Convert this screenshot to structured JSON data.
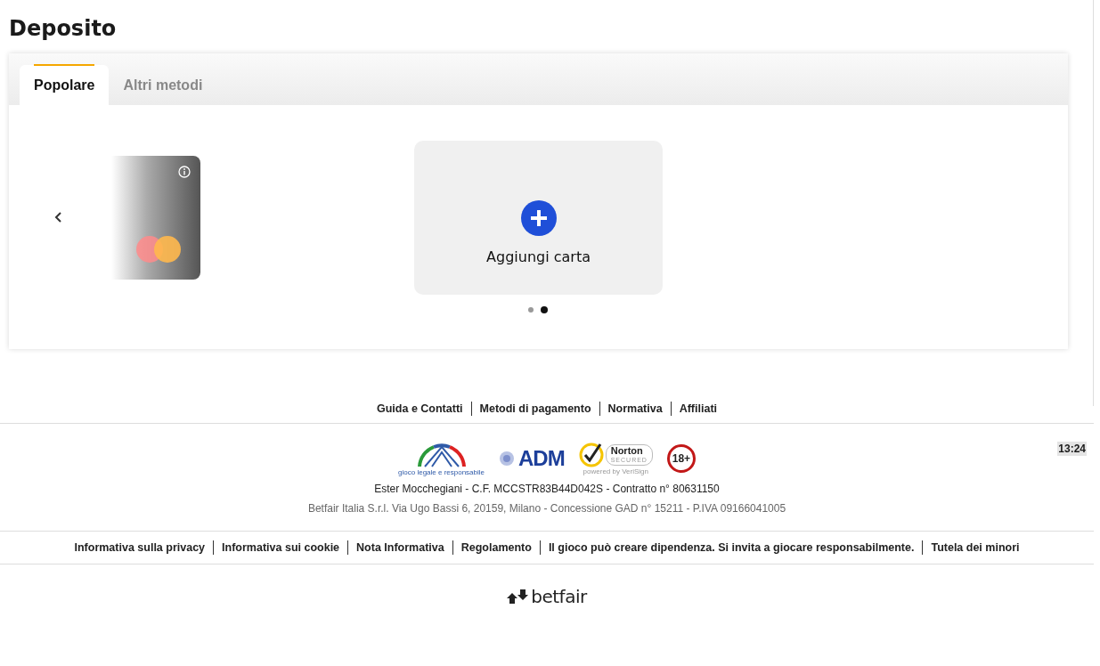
{
  "page_title": "Deposito",
  "tabs": [
    {
      "label": "Popolare",
      "selected": true
    },
    {
      "label": "Altri metodi",
      "selected": false
    }
  ],
  "carousel": {
    "saved_card": {
      "kind": "mastercard"
    },
    "add_card": {
      "label": "Aggiungi carta"
    },
    "pages": [
      {
        "selected": false
      },
      {
        "selected": true
      }
    ]
  },
  "footer": {
    "top_links": [
      "Guida e Contatti",
      "Metodi di pagamento",
      "Normativa",
      "Affiliati"
    ],
    "badges": [
      {
        "kind": "aams",
        "text": "gioco legale e responsabile"
      },
      {
        "kind": "adm",
        "text": "ADM"
      },
      {
        "kind": "norton",
        "text": "Norton",
        "subtext": "SECURED",
        "caption": "powered by VeriSign"
      },
      {
        "kind": "age",
        "text": "18+"
      }
    ],
    "time": "13:24",
    "account_line": "Ester Mocchegiani - C.F. MCCSTR83B44D042S - Contratto n° 80631150",
    "company_line": "Betfair Italia S.r.l. Via Ugo Bassi 6, 20159, Milano - Concessione GAD n° 15211 - P.IVA 09166041005",
    "legal_links": [
      "Informativa sulla privacy",
      "Informativa sui cookie",
      "Nota Informativa",
      "Regolamento",
      "Il gioco può creare dipendenza. Si invita a giocare responsabilmente.",
      "Tutela dei minori"
    ],
    "brand": "betfair"
  }
}
